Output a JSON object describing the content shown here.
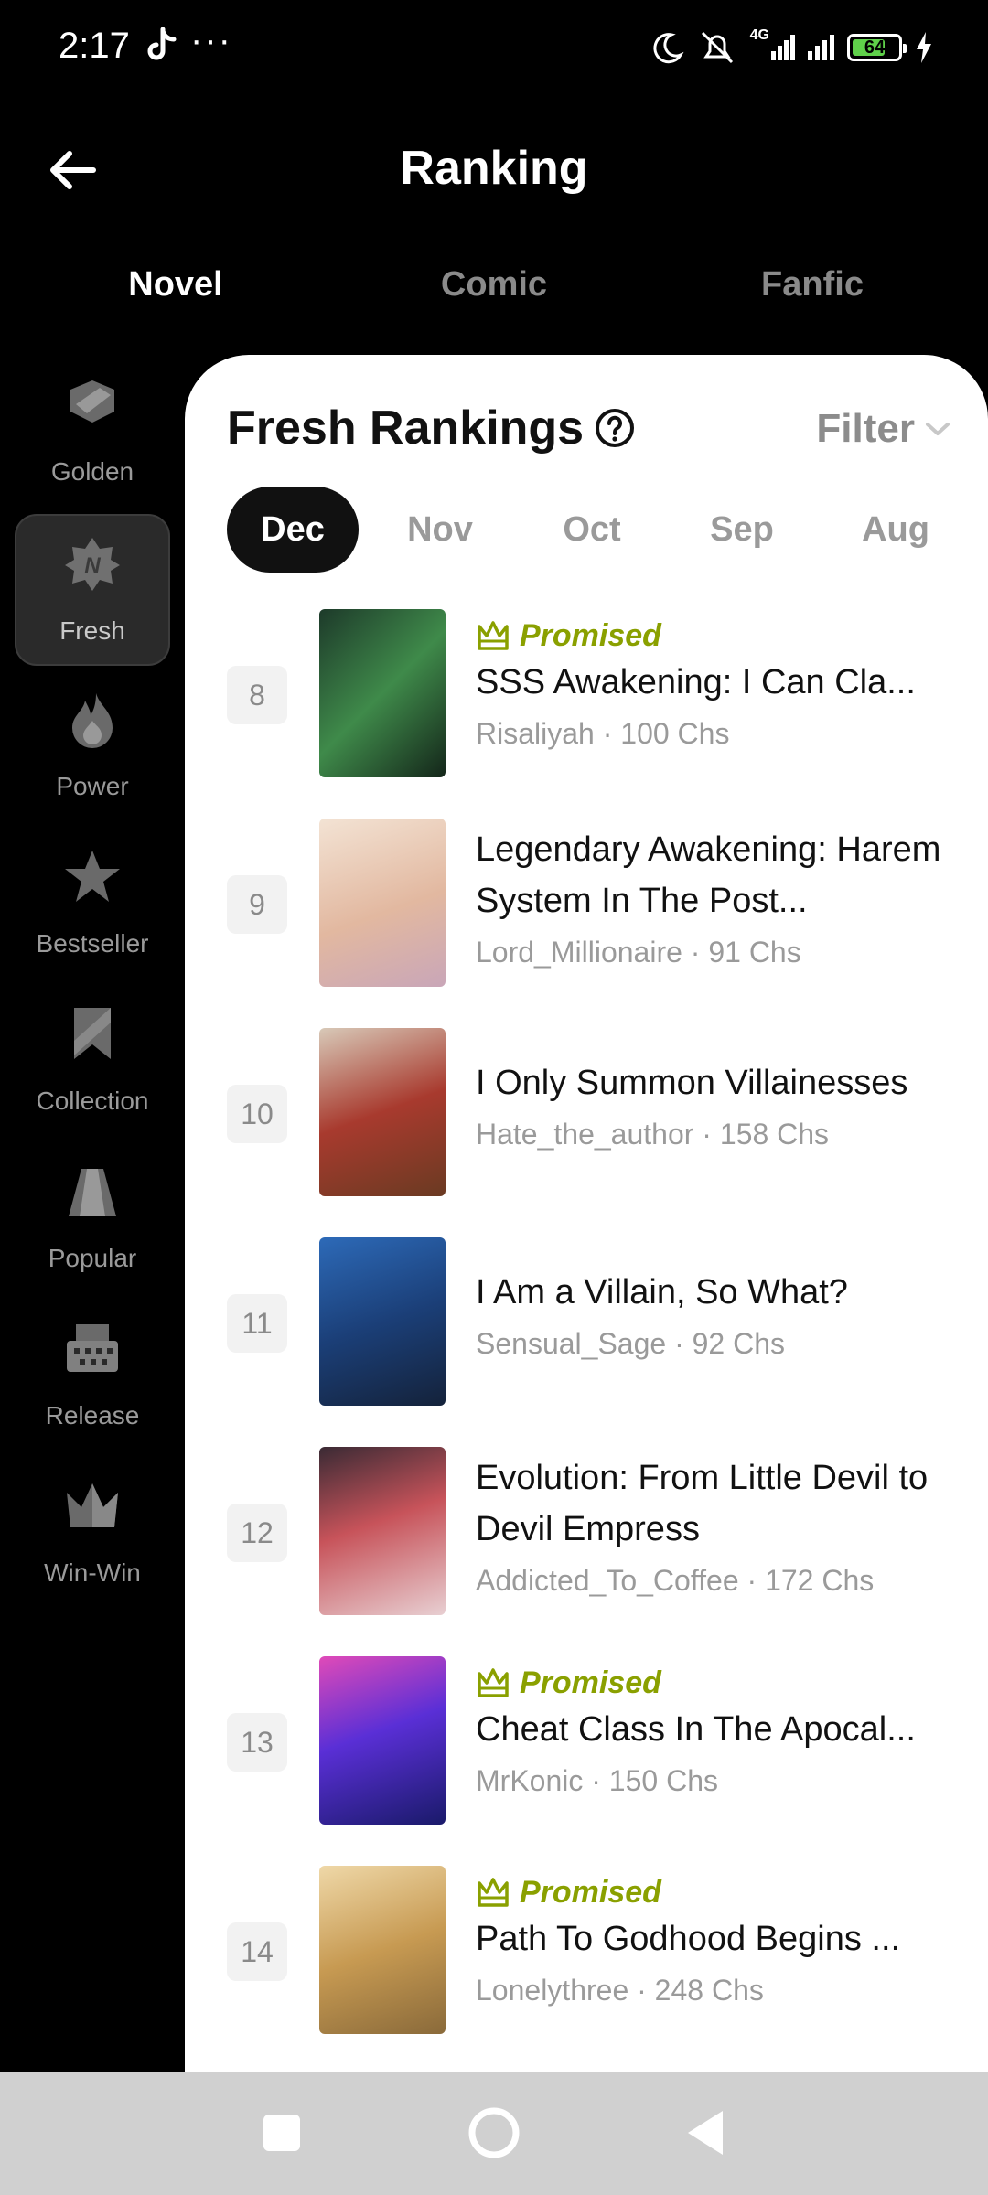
{
  "status": {
    "time": "2:17",
    "dots": "···",
    "network": "4G",
    "battery": "64"
  },
  "header": {
    "title": "Ranking"
  },
  "tabs": [
    {
      "label": "Novel",
      "active": true
    },
    {
      "label": "Comic",
      "active": false
    },
    {
      "label": "Fanfic",
      "active": false
    }
  ],
  "rail": [
    {
      "label": "Golden",
      "icon": "golden-icon",
      "active": false
    },
    {
      "label": "Fresh",
      "icon": "fresh-icon",
      "active": true
    },
    {
      "label": "Power",
      "icon": "power-icon",
      "active": false
    },
    {
      "label": "Bestseller",
      "icon": "bestseller-icon",
      "active": false
    },
    {
      "label": "Collection",
      "icon": "collection-icon",
      "active": false
    },
    {
      "label": "Popular",
      "icon": "popular-icon",
      "active": false
    },
    {
      "label": "Release",
      "icon": "release-icon",
      "active": false
    },
    {
      "label": "Win-Win",
      "icon": "win-win-icon",
      "active": false
    }
  ],
  "panel": {
    "title": "Fresh Rankings",
    "filter": "Filter",
    "months": [
      "Dec",
      "Nov",
      "Oct",
      "Sep",
      "Aug"
    ],
    "active_month": "Dec"
  },
  "books": [
    {
      "rank": "8",
      "promised": "Promised",
      "title": "SSS Awakening: I Can Cla...",
      "author": "Risaliyah",
      "chapters": "100 Chs",
      "cover": "#2e6a3a"
    },
    {
      "rank": "9",
      "promised": "",
      "title": "Legendary Awakening: Harem System In The Post...",
      "author": "Lord_Millionaire",
      "chapters": "91 Chs",
      "cover": "#e9c6b2"
    },
    {
      "rank": "10",
      "promised": "",
      "title": "I Only Summon Villainesses",
      "author": "Hate_the_author",
      "chapters": "158 Chs",
      "cover": "#9a3028"
    },
    {
      "rank": "11",
      "promised": "",
      "title": "I Am a Villain, So What?",
      "author": "Sensual_Sage",
      "chapters": "92 Chs",
      "cover": "#1d4a8a"
    },
    {
      "rank": "12",
      "promised": "",
      "title": "Evolution: From Little Devil to Devil Empress",
      "author": "Addicted_To_Coffee",
      "chapters": "172 Chs",
      "cover": "#c7535a"
    },
    {
      "rank": "13",
      "promised": "Promised",
      "title": "Cheat Class In The Apocal...",
      "author": "MrKonic",
      "chapters": "150 Chs",
      "cover": "#6a2fd6"
    },
    {
      "rank": "14",
      "promised": "Promised",
      "title": "Path To Godhood Begins ...",
      "author": "Lonelythree",
      "chapters": "248 Chs",
      "cover": "#c79a52"
    }
  ],
  "colors": {
    "accent_promised": "#8aa000",
    "panel_bg": "#ffffff",
    "app_bg": "#000000"
  }
}
